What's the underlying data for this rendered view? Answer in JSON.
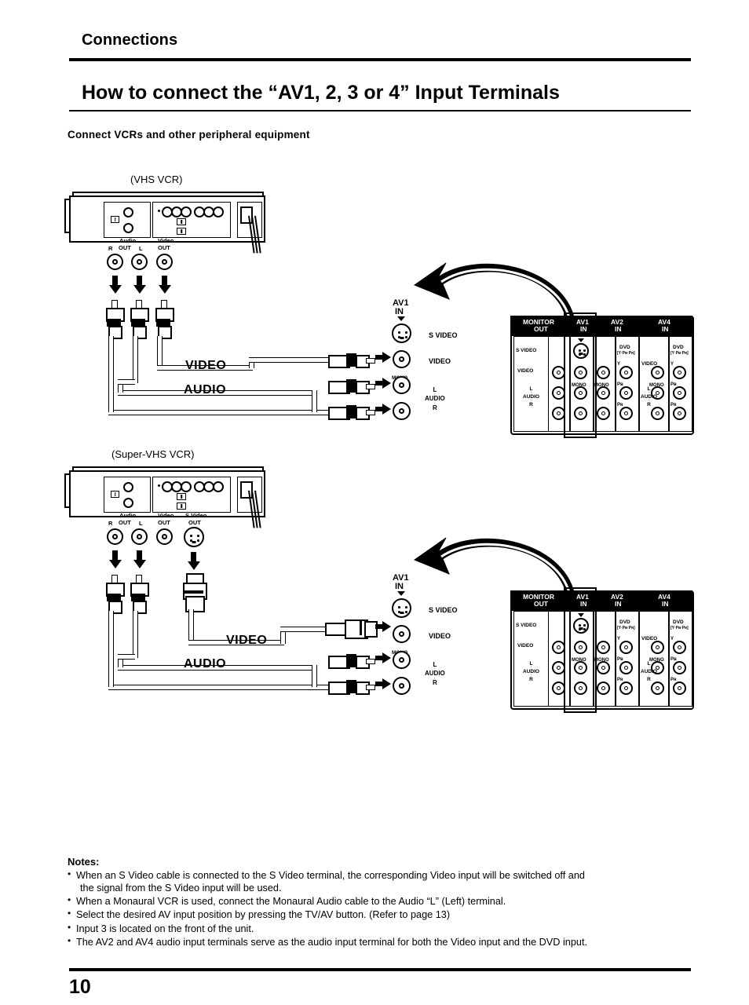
{
  "header": {
    "chapter": "Connections",
    "section_title": "How to connect the “AV1, 2, 3 or 4” Input Terminals",
    "subtitle": "Connect VCRs and other peripheral equipment"
  },
  "diagram1": {
    "caption": "(VHS VCR)",
    "vcr_outputs": {
      "audio_group": "Audio",
      "audio_out": "OUT",
      "right": "R",
      "left": "L",
      "video_group": "Video",
      "video_out": "OUT"
    },
    "cable_labels": {
      "video": "VIDEO",
      "audio": "AUDIO"
    },
    "input_block": {
      "title_line1": "AV1",
      "title_line2": "IN",
      "mono": "MONO",
      "jacks": [
        "S VIDEO",
        "VIDEO"
      ],
      "audio_l": "L",
      "audio": "AUDIO",
      "audio_r": "R"
    }
  },
  "diagram2": {
    "caption": "(Super-VHS VCR)",
    "vcr_outputs": {
      "audio_group": "Audio",
      "audio_out": "OUT",
      "right": "R",
      "left": "L",
      "video_group": "Video",
      "video_out": "OUT",
      "svideo_group": "S Video",
      "svideo_out": "OUT"
    },
    "cable_labels": {
      "video": "VIDEO",
      "audio": "AUDIO"
    },
    "input_block": {
      "title_line1": "AV1",
      "title_line2": "IN",
      "mono": "MONO",
      "jacks": [
        "S VIDEO",
        "VIDEO"
      ],
      "audio_l": "L",
      "audio": "AUDIO",
      "audio_r": "R"
    }
  },
  "terminal_panel": {
    "columns": [
      {
        "header_line1": "MONITOR",
        "header_line2": "OUT"
      },
      {
        "header_line1": "AV1",
        "header_line2": "IN"
      },
      {
        "header_line1": "AV2",
        "header_line2": "IN"
      },
      {
        "header_line1": "AV4",
        "header_line2": "IN"
      }
    ],
    "row_labels": {
      "svideo": "S VIDEO",
      "video": "VIDEO",
      "mono": "MONO",
      "audio_l": "L",
      "audio": "AUDIO",
      "audio_r": "R"
    },
    "dvd": {
      "label": "DVD",
      "components": "[Y·Pʙ·Pʀ]",
      "y": "Y",
      "pb": "Pʙ",
      "pr": "Pʀ"
    }
  },
  "notes": {
    "title": "Notes:",
    "items": [
      "When an S Video cable is connected to the S Video terminal, the corresponding Video input will be switched off  and",
      "the signal from the S Video input will be used.",
      "When a Monaural VCR is used, connect the Monaural Audio cable to the Audio “L” (Left) terminal.",
      "Select the desired AV input position by pressing the TV/AV button. (Refer to page 13)",
      "Input 3 is located on the front of the unit.",
      "The AV2 and AV4 audio input terminals serve as the audio input terminal for both the Video input and  the DVD input."
    ]
  },
  "footer": {
    "page_number": "10"
  }
}
